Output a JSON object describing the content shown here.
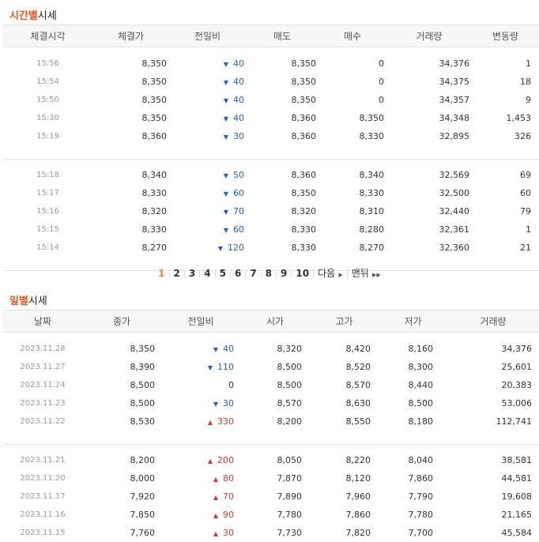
{
  "time_section": {
    "title_highlight": "시간별",
    "title_rest": "시세",
    "headers": [
      "체결시각",
      "체결가",
      "전일비",
      "매도",
      "매수",
      "거래량",
      "변동량"
    ],
    "rows": [
      {
        "time": "15:56",
        "price": "8,350",
        "dir": "down",
        "chg": "40",
        "ask": "8,350",
        "bid": "0",
        "vol": "34,376",
        "delta": "1"
      },
      {
        "time": "15:54",
        "price": "8,350",
        "dir": "down",
        "chg": "40",
        "ask": "8,350",
        "bid": "0",
        "vol": "34,375",
        "delta": "18"
      },
      {
        "time": "15:50",
        "price": "8,350",
        "dir": "down",
        "chg": "40",
        "ask": "8,350",
        "bid": "0",
        "vol": "34,357",
        "delta": "9"
      },
      {
        "time": "15:30",
        "price": "8,350",
        "dir": "down",
        "chg": "40",
        "ask": "8,360",
        "bid": "8,350",
        "vol": "34,348",
        "delta": "1,453"
      },
      {
        "time": "15:19",
        "price": "8,360",
        "dir": "down",
        "chg": "30",
        "ask": "8,360",
        "bid": "8,330",
        "vol": "32,895",
        "delta": "326"
      },
      {
        "time": "15:18",
        "price": "8,340",
        "dir": "down",
        "chg": "50",
        "ask": "8,360",
        "bid": "8,340",
        "vol": "32,569",
        "delta": "69"
      },
      {
        "time": "15:17",
        "price": "8,330",
        "dir": "down",
        "chg": "60",
        "ask": "8,350",
        "bid": "8,330",
        "vol": "32,500",
        "delta": "60"
      },
      {
        "time": "15:16",
        "price": "8,320",
        "dir": "down",
        "chg": "70",
        "ask": "8,320",
        "bid": "8,310",
        "vol": "32,440",
        "delta": "79"
      },
      {
        "time": "15:15",
        "price": "8,330",
        "dir": "down",
        "chg": "60",
        "ask": "8,330",
        "bid": "8,280",
        "vol": "32,361",
        "delta": "1"
      },
      {
        "time": "15:14",
        "price": "8,270",
        "dir": "down",
        "chg": "120",
        "ask": "8,330",
        "bid": "8,270",
        "vol": "32,360",
        "delta": "21"
      }
    ]
  },
  "pagination": {
    "pages": [
      "1",
      "2",
      "3",
      "4",
      "5",
      "6",
      "7",
      "8",
      "9",
      "10"
    ],
    "active": "1",
    "next_label": "다음",
    "last_label": "맨뒤",
    "next_icon": "triangle-right",
    "last_icon": "double-triangle-right"
  },
  "daily_section": {
    "title_highlight": "일별",
    "title_rest": "시세",
    "headers": [
      "날짜",
      "종가",
      "전일비",
      "시가",
      "고가",
      "저가",
      "거래량"
    ],
    "rows": [
      {
        "date": "2023.11.28",
        "close": "8,350",
        "dir": "down",
        "chg": "40",
        "open": "8,320",
        "high": "8,420",
        "low": "8,160",
        "vol": "34,376"
      },
      {
        "date": "2023.11.27",
        "close": "8,390",
        "dir": "down",
        "chg": "110",
        "open": "8,500",
        "high": "8,520",
        "low": "8,300",
        "vol": "25,601"
      },
      {
        "date": "2023.11.24",
        "close": "8,500",
        "dir": "flat",
        "chg": "0",
        "open": "8,500",
        "high": "8,570",
        "low": "8,440",
        "vol": "20,383"
      },
      {
        "date": "2023.11.23",
        "close": "8,500",
        "dir": "down",
        "chg": "30",
        "open": "8,570",
        "high": "8,630",
        "low": "8,500",
        "vol": "53,006"
      },
      {
        "date": "2023.11.22",
        "close": "8,530",
        "dir": "up",
        "chg": "330",
        "open": "8,200",
        "high": "8,550",
        "low": "8,180",
        "vol": "112,741"
      },
      {
        "date": "2023.11.21",
        "close": "8,200",
        "dir": "up",
        "chg": "200",
        "open": "8,050",
        "high": "8,220",
        "low": "8,040",
        "vol": "38,581"
      },
      {
        "date": "2023.11.20",
        "close": "8,000",
        "dir": "up",
        "chg": "80",
        "open": "7,870",
        "high": "8,120",
        "low": "7,860",
        "vol": "44,581"
      },
      {
        "date": "2023.11.17",
        "close": "7,920",
        "dir": "up",
        "chg": "70",
        "open": "7,890",
        "high": "7,960",
        "low": "7,790",
        "vol": "19,608"
      },
      {
        "date": "2023.11.16",
        "close": "7,850",
        "dir": "up",
        "chg": "90",
        "open": "7,780",
        "high": "7,860",
        "low": "7,780",
        "vol": "21,165"
      },
      {
        "date": "2023.11.15",
        "close": "7,760",
        "dir": "up",
        "chg": "30",
        "open": "7,730",
        "high": "7,820",
        "low": "7,700",
        "vol": "45,584"
      }
    ]
  },
  "colors": {
    "accent": "#e8561a",
    "down": "#1a5fc9",
    "up": "#d23a2a",
    "active_page": "#f07d24"
  }
}
